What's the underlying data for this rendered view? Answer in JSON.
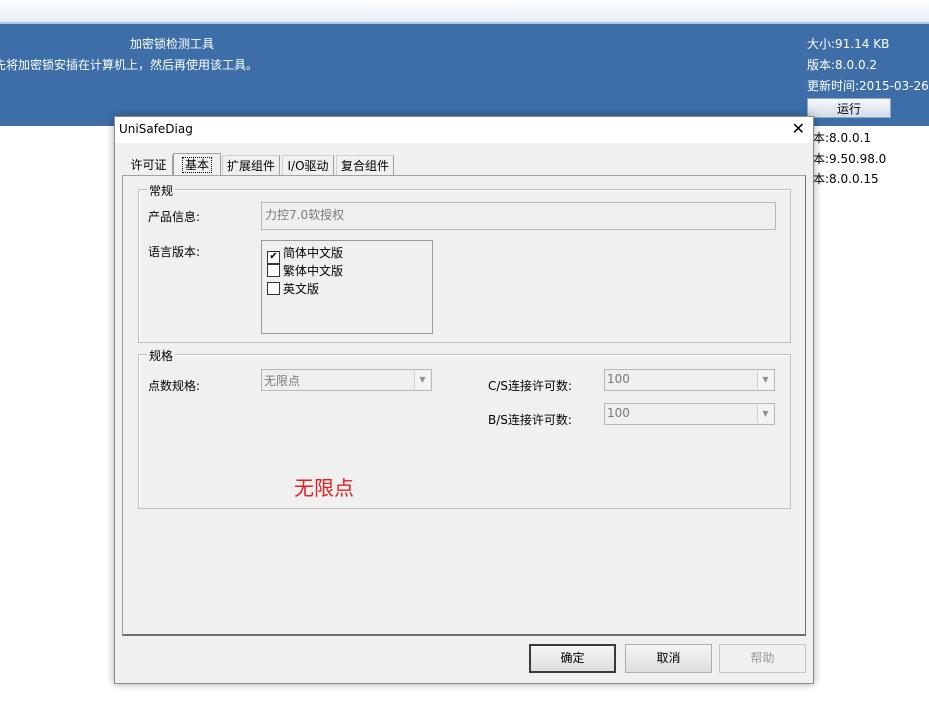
{
  "background_app": {
    "title": "加密锁检测工具",
    "description": "先将加密锁安插在计算机上，然后再使用该工具。",
    "size": "大小:91.14 KB",
    "version": "版本:8.0.0.2",
    "updated": "更新时间:2015-03-26",
    "run_button": "运行",
    "version_lines": [
      "本:8.0.0.1",
      "本:9.50.98.0",
      "本:8.0.0.15"
    ]
  },
  "dialog": {
    "title": "UniSafeDiag",
    "close_glyph": "✕",
    "tabs": [
      {
        "label": "许可证",
        "active": false
      },
      {
        "label": "基本",
        "active": true
      },
      {
        "label": "扩展组件",
        "active": false
      },
      {
        "label": "I/O驱动",
        "active": false
      },
      {
        "label": "复合组件",
        "active": false
      }
    ],
    "general": {
      "legend": "常规",
      "product_label": "产品信息:",
      "product_value": "力控7.0软授权",
      "language_label": "语言版本:",
      "languages": [
        {
          "label": "简体中文版",
          "checked": true
        },
        {
          "label": "繁体中文版",
          "checked": false
        },
        {
          "label": "英文版",
          "checked": false
        }
      ]
    },
    "spec": {
      "legend": "规格",
      "points_label": "点数规格:",
      "points_value": "无限点",
      "cs_label": "C/S连接许可数:",
      "cs_value": "100",
      "bs_label": "B/S连接许可数:",
      "bs_value": "100",
      "note": "无限点"
    },
    "buttons": {
      "ok": "确定",
      "cancel": "取消",
      "help": "帮助"
    }
  },
  "colors": {
    "banner": "#3d6ea8",
    "dialog_bg": "#f0f0f0",
    "note_red": "#e02020"
  }
}
